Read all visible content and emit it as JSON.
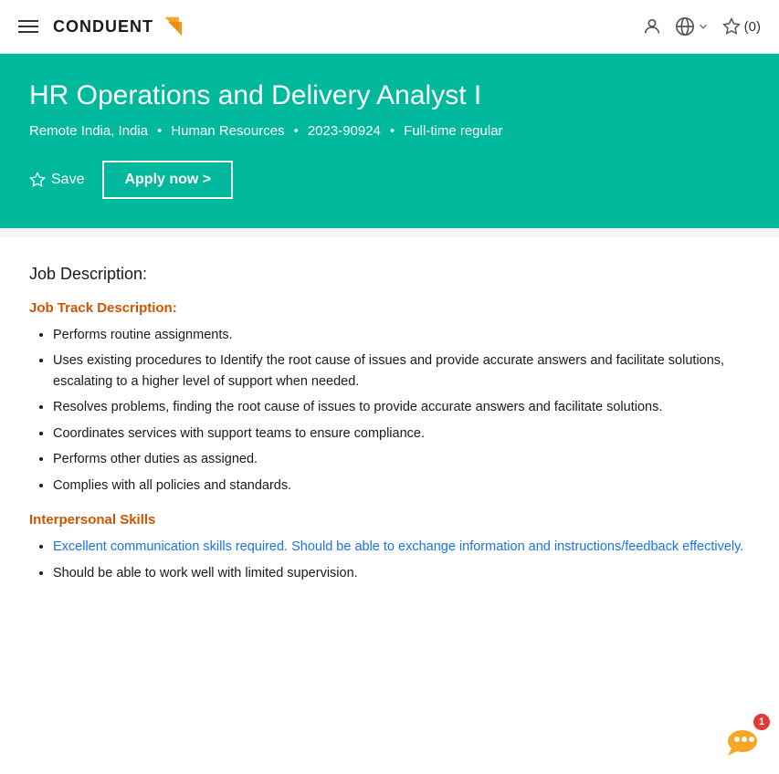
{
  "header": {
    "logo_text": "CONDUENT",
    "nav_icon_label": "menu",
    "user_icon_label": "user",
    "globe_icon_label": "globe",
    "dropdown_icon_label": "chevron-down",
    "star_icon_label": "star",
    "saved_count": "(0)"
  },
  "hero": {
    "title": "HR Operations and Delivery Analyst I",
    "location": "Remote India, India",
    "department": "Human Resources",
    "job_id": "2023-90924",
    "job_type": "Full-time regular",
    "save_label": "Save",
    "apply_label": "Apply now >"
  },
  "content": {
    "job_description_heading": "Job Description:",
    "job_track_heading": "Job Track Description:",
    "job_track_bullets": [
      "Performs routine assignments.",
      "Uses existing procedures to Identify the root cause of issues and provide accurate answers and facilitate solutions, escalating to a higher level of support when needed.",
      "Resolves problems, finding the root cause of issues to provide accurate answers and facilitate solutions.",
      "Coordinates services with support teams to ensure compliance.",
      "Performs other duties as assigned.",
      "Complies with all policies and standards."
    ],
    "interpersonal_heading": "Interpersonal Skills",
    "interpersonal_bullets": [
      "Excellent communication skills required. Should be able to exchange information and instructions/feedback effectively.",
      "Should be able to work well with limited supervision."
    ]
  },
  "notification": {
    "badge_count": "1"
  }
}
